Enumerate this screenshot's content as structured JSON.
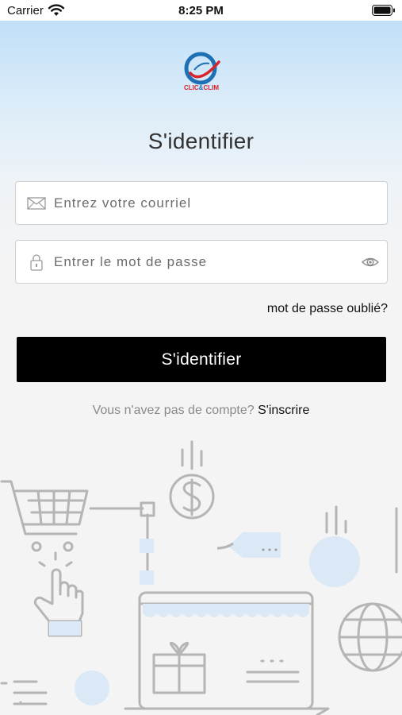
{
  "status_bar": {
    "carrier": "Carrier",
    "time": "8:25 PM",
    "icons": [
      "wifi-icon",
      "battery-icon"
    ]
  },
  "logo": {
    "brand_left": "CLIC",
    "brand_amp": "&",
    "brand_right": "CLIM",
    "colors": {
      "red": "#d8232a",
      "blue": "#1f6fb5"
    }
  },
  "title": "S'identifier",
  "email_field": {
    "placeholder": "Entrez votre courriel",
    "value": "",
    "icon": "envelope-icon"
  },
  "password_field": {
    "placeholder": "Entrer le mot de passe",
    "value": "",
    "icon": "lock-icon",
    "toggle_icon": "eye-icon"
  },
  "forgot_password": "mot de passe oublié?",
  "login_button": "S'identifier",
  "signup": {
    "prompt": "Vous n'avez pas de compte?",
    "link": "S'inscrire"
  },
  "colors": {
    "primary_button": "#000000",
    "background": "#f4f4f5",
    "gradient_top": "#b9dcf7",
    "illustration_line": "#b5b5b5",
    "illustration_accent": "#dbe9f6"
  }
}
